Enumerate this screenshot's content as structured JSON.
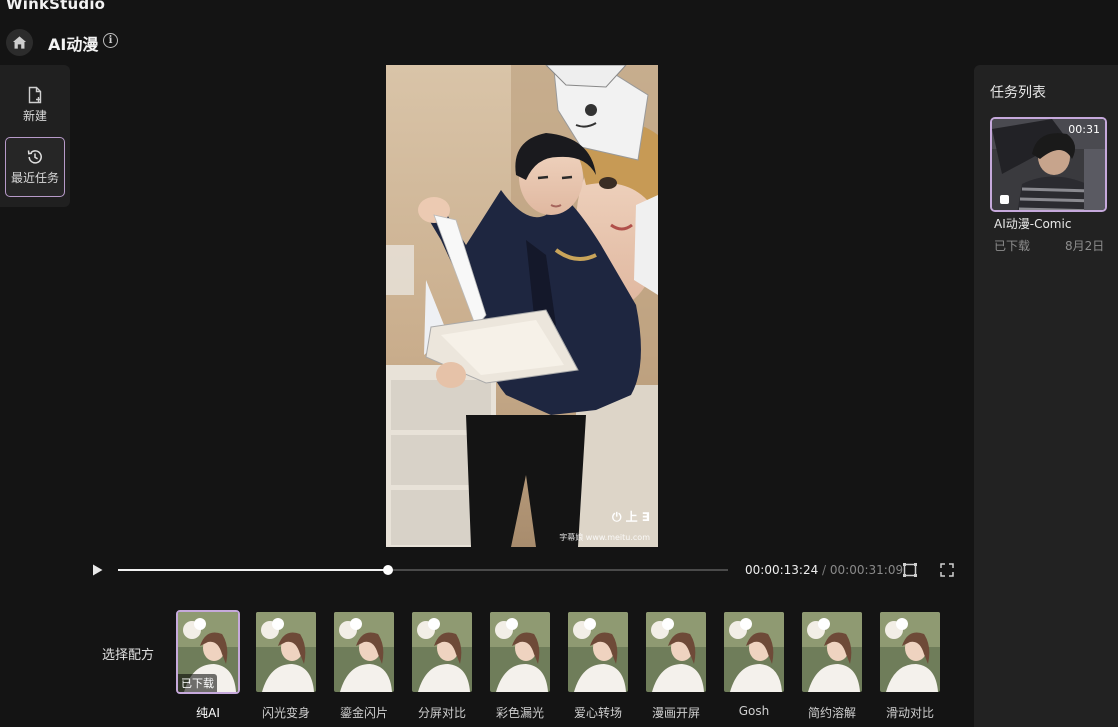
{
  "app": {
    "title": "WinkStudio"
  },
  "header": {
    "title": "AI动漫"
  },
  "sidebar": {
    "new_label": "新建",
    "recent_label": "最近任务"
  },
  "video": {
    "watermark_logo": "⏻ 上 ∃",
    "watermark_text": "字幕娘 www.meitu.com"
  },
  "player": {
    "current_time": "00:00:13:24",
    "separator": " / ",
    "total_time": "00:00:31:09",
    "progress": 0.443
  },
  "presets": {
    "label": "选择配方",
    "downloaded_badge": "已下载",
    "items": [
      {
        "name": "纯AI",
        "selected": true
      },
      {
        "name": "闪光变身"
      },
      {
        "name": "鎏金闪片"
      },
      {
        "name": "分屏对比"
      },
      {
        "name": "彩色漏光"
      },
      {
        "name": "爱心转场"
      },
      {
        "name": "漫画开屏"
      },
      {
        "name": "Gosh"
      },
      {
        "name": "简约溶解"
      },
      {
        "name": "滑动对比"
      }
    ]
  },
  "task_list": {
    "title": "任务列表",
    "items": [
      {
        "name": "AI动漫-Comic",
        "duration": "00:31",
        "status": "已下载",
        "date": "8月2日"
      }
    ]
  }
}
